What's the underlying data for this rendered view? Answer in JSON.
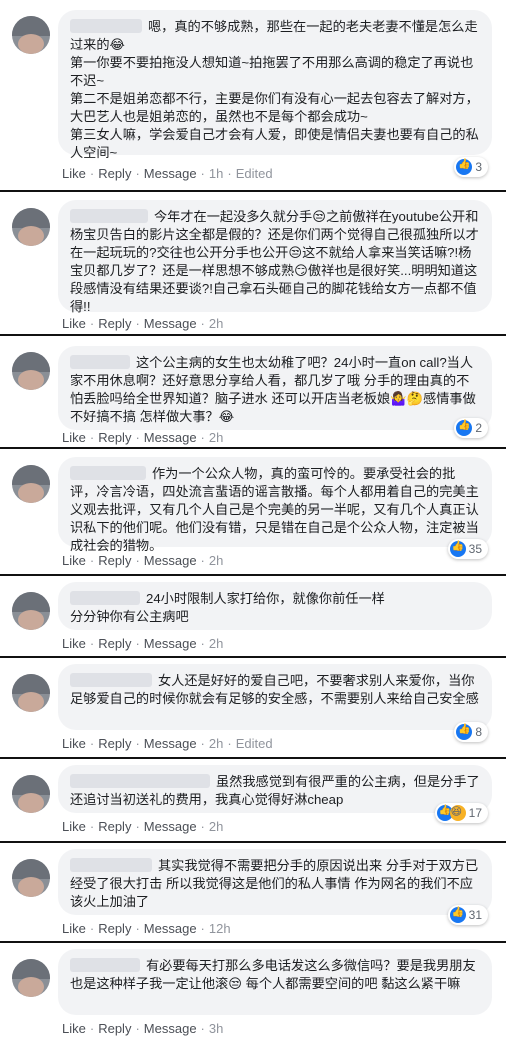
{
  "comments": [
    {
      "text": "嗯，真的不够成熟，那些在一起的老夫老妻不懂是怎么走过来的😂\n第一你要不要拍拖没人想知道~拍拖罢了不用那么高调的稳定了再说也不迟~\n第二不是姐弟恋都不行，主要是你们有没有心一起去包容去了解对方，大巴艺人也是姐弟恋的，虽然也不是每个都会成功~\n第三女人嘛，学会爱自己才会有人爱，即使是情侣夫妻也要有自己的私人空间~",
      "like": "Like",
      "reply": "Reply",
      "message": "Message",
      "time": "1h",
      "edited": "Edited",
      "reaction_count": "3"
    },
    {
      "text": "今年才在一起没多久就分手😒之前傲祥在youtube公开和杨宝贝告白的影片这全都是假的？还是你们两个觉得自己很孤独所以才在一起玩玩的?交往也公开分手也公开😒这不就给人拿来当笑话嘛?!杨宝贝都几岁了？还是一样思想不够成熟😏傲祥也是很好笑...明明知道这段感情没有结果还要谈?!自己拿石头砸自己的脚花钱给女方一点都不值得!!",
      "like": "Like",
      "reply": "Reply",
      "message": "Message",
      "time": "2h"
    },
    {
      "text": "这个公主病的女生也太幼稚了吧？24小时一直on call?当人家不用休息啊？还好意思分享给人看，都几岁了哦 分手的理由真的不怕丢脸吗给全世界知道？脑子进水 还可以开店当老板娘🤷‍♀️🤔感情事做不好搞不搞 怎样做大事？😂",
      "like": "Like",
      "reply": "Reply",
      "message": "Message",
      "time": "2h",
      "reaction_count": "2"
    },
    {
      "text": "作为一个公众人物，真的蛮可怜的。要承受社会的批评，冷言冷语，四处流言蜚语的谣言散播。每个人都用着自己的完美主义观去批评，又有几个人自己是个完美的另一半呢，又有几个人真正认识私下的他们呢。他们没有错，只是错在自己是个公众人物，注定被当成社会的猎物。",
      "like": "Like",
      "reply": "Reply",
      "message": "Message",
      "time": "2h",
      "reaction_count": "35"
    },
    {
      "text": "24小时限制人家打给你，就像你前任一样\n分分钟你有公主病吧",
      "like": "Like",
      "reply": "Reply",
      "message": "Message",
      "time": "2h"
    },
    {
      "text": "女人还是好好的爱自己吧，不要奢求别人来爱你，当你足够爱自己的时候你就会有足够的安全感，不需要别人来给自己安全感",
      "like": "Like",
      "reply": "Reply",
      "message": "Message",
      "time": "2h",
      "edited": "Edited",
      "reaction_count": "8"
    },
    {
      "text": "虽然我感觉到有很严重的公主病，但是分手了还追讨当初送礼的费用，我真心觉得好淋cheap",
      "like": "Like",
      "reply": "Reply",
      "message": "Message",
      "time": "2h",
      "reaction_count": "17"
    },
    {
      "text": "其实我觉得不需要把分手的原因说出来 分手对于双方已经受了很大打击 所以我觉得这是他们的私人事情 作为网名的我们不应该火上加油了",
      "like": "Like",
      "reply": "Reply",
      "message": "Message",
      "time": "12h",
      "reaction_count": "31"
    },
    {
      "text": "有必要每天打那么多电话发这么多微信吗？要是我男朋友也是这种样子我一定让他滚😒 每个人都需要空间的吧 黏这么紧干嘛",
      "like": "Like",
      "reply": "Reply",
      "message": "Message",
      "time": "3h"
    }
  ]
}
